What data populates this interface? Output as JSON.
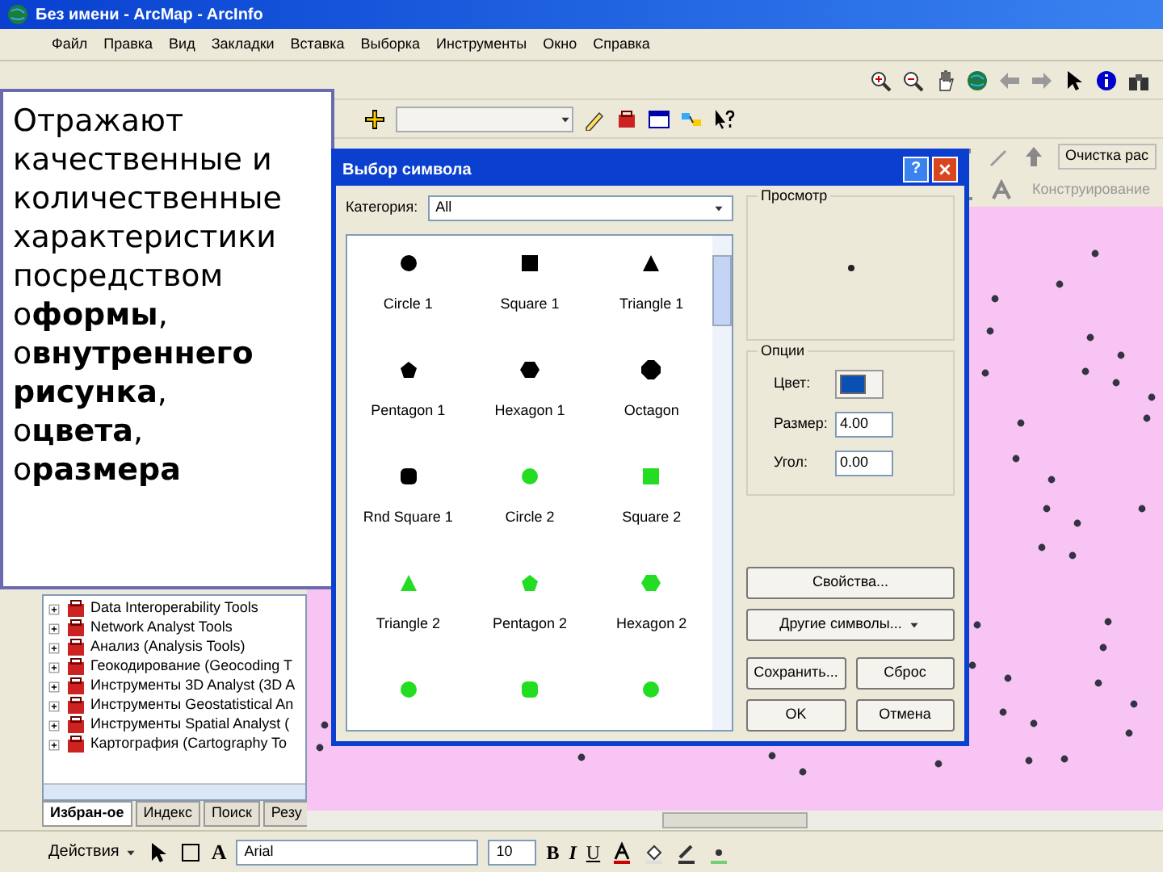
{
  "window": {
    "title": "Без имени - ArcMap - ArcInfo"
  },
  "menu": [
    "Файл",
    "Правка",
    "Вид",
    "Закладки",
    "Вставка",
    "Выборка",
    "Инструменты",
    "Окно",
    "Справка"
  ],
  "toolbar": {
    "buttons": [
      "Очистка рас",
      "Конструирование"
    ]
  },
  "callout": {
    "text": "Отражают качественные и количественные характеристики посредством",
    "bullets": [
      "о**формы**,",
      "о**внутреннего рисунка**,",
      "о**цвета**,",
      "о**размера**"
    ]
  },
  "toolbox": {
    "items": [
      {
        "label": "Data Interoperability Tools"
      },
      {
        "label": "Network Analyst Tools"
      },
      {
        "label": "Анализ (Analysis Tools)"
      },
      {
        "label": "Геокодирование (Geocoding T"
      },
      {
        "label": "Инструменты 3D Analyst (3D A"
      },
      {
        "label": "Инструменты Geostatistical An"
      },
      {
        "label": "Инструменты Spatial Analyst ("
      },
      {
        "label": "Картография (Cartography To"
      }
    ],
    "tabs": [
      {
        "label": "Избран-ое",
        "selected": true
      },
      {
        "label": "Индекс",
        "selected": false
      },
      {
        "label": "Поиск",
        "selected": false
      },
      {
        "label": "Резу",
        "selected": false
      }
    ]
  },
  "dialog": {
    "title": "Выбор символа",
    "help": "?",
    "category_label": "Категория:",
    "category": "All",
    "symbols": [
      {
        "label": "Circle 1",
        "kind": "circle",
        "color": "#000000"
      },
      {
        "label": "Square 1",
        "kind": "square",
        "color": "#000000"
      },
      {
        "label": "Triangle 1",
        "kind": "triangle",
        "color": "#000000"
      },
      {
        "label": "Pentagon 1",
        "kind": "pentagon",
        "color": "#000000"
      },
      {
        "label": "Hexagon 1",
        "kind": "hexagon",
        "color": "#000000"
      },
      {
        "label": "Octagon",
        "kind": "octagon",
        "color": "#000000"
      },
      {
        "label": "Rnd Square 1",
        "kind": "rounded",
        "color": "#000000"
      },
      {
        "label": "Circle 2",
        "kind": "circle",
        "color": "#22dd22"
      },
      {
        "label": "Square 2",
        "kind": "square",
        "color": "#22dd22"
      },
      {
        "label": "Triangle 2",
        "kind": "triangle",
        "color": "#22dd22"
      },
      {
        "label": "Pentagon 2",
        "kind": "pentagon",
        "color": "#22dd22"
      },
      {
        "label": "Hexagon 2",
        "kind": "hexagon",
        "color": "#22dd22"
      },
      {
        "kind": "circle",
        "color": "#22dd22"
      },
      {
        "kind": "rounded",
        "color": "#22dd22"
      },
      {
        "kind": "circle",
        "color": "#22dd22"
      }
    ],
    "preview_label": "Просмотр",
    "options_label": "Опции",
    "color_label": "Цвет:",
    "color": "#0a4fb4",
    "size_label": "Размер:",
    "size": "4.00",
    "angle_label": "Угол:",
    "angle": "0.00",
    "buttons": [
      "Свойства...",
      "Другие символы...",
      "Сохранить...",
      "Сброс",
      "OK",
      "Отмена"
    ]
  },
  "draw_toolbar": {
    "actions": "Действия",
    "text_tool": "A",
    "font": "Arial",
    "font_size": "10",
    "format_buttons": [
      "B",
      "I",
      "U"
    ]
  }
}
